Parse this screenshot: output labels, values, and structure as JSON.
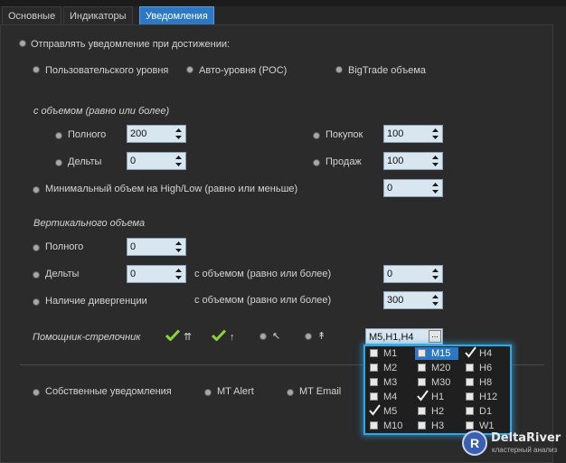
{
  "tabs": [
    {
      "label": "Основные"
    },
    {
      "label": "Индикаторы"
    },
    {
      "label": "Уведомления",
      "active": true
    }
  ],
  "notify": {
    "header": "Отправлять уведомление при  достижении:",
    "levels": [
      "Пользовательского уровня",
      "Авто-уровня (POC)",
      "BigTrade объема"
    ]
  },
  "volume": {
    "title": "с объемом (равно или более)",
    "full_label": "Полного",
    "full_value": "200",
    "delta_label": "Дельты",
    "delta_value": "0",
    "buy_label": "Покупок",
    "buy_value": "100",
    "sell_label": "Продаж",
    "sell_value": "100",
    "minvol_label": "Минимальный объем на High/Low (равно или меньше)",
    "minvol_value": "0"
  },
  "vertical": {
    "title": "Вертикального объема",
    "full_label": "Полного",
    "full_value": "0",
    "delta_label": "Дельты",
    "delta_value": "0",
    "delta_cond": "с объемом (равно или более)",
    "delta_cond_value": "0",
    "div_label": "Наличие дивергенции",
    "div_cond": "с объемом (равно или более)",
    "div_cond_value": "300"
  },
  "helper": {
    "label": "Помощник-стрелочник",
    "opt1": "⇈",
    "opt2": "↑",
    "opt3": "↖",
    "opt4": "↟",
    "timeframes": "M5,H1,H4",
    "more": "..."
  },
  "own": {
    "label": "Собственные уведомления",
    "mt_alert": "MT Alert",
    "mt_email": "MT Email"
  },
  "popup": {
    "items": [
      {
        "label": "M1",
        "checked": false
      },
      {
        "label": "M15",
        "checked": false,
        "selected": true
      },
      {
        "label": "H4",
        "checked": true
      },
      {
        "label": "M2",
        "checked": false
      },
      {
        "label": "M20",
        "checked": false
      },
      {
        "label": "H6",
        "checked": false
      },
      {
        "label": "M3",
        "checked": false
      },
      {
        "label": "M30",
        "checked": false
      },
      {
        "label": "H8",
        "checked": false
      },
      {
        "label": "M4",
        "checked": false
      },
      {
        "label": "H1",
        "checked": true
      },
      {
        "label": "H12",
        "checked": false
      },
      {
        "label": "M5",
        "checked": true
      },
      {
        "label": "H2",
        "checked": false
      },
      {
        "label": "D1",
        "checked": false
      },
      {
        "label": "M10",
        "checked": false
      },
      {
        "label": "H3",
        "checked": false
      },
      {
        "label": "W1",
        "checked": false
      }
    ]
  },
  "logo": {
    "badge": "R",
    "name": "DeltaRiver",
    "sub": "кластерный анализ"
  },
  "colors": {
    "accent": "#2b78c6",
    "check_green": "#8cd43a",
    "popup_border": "#2fa8e8"
  }
}
